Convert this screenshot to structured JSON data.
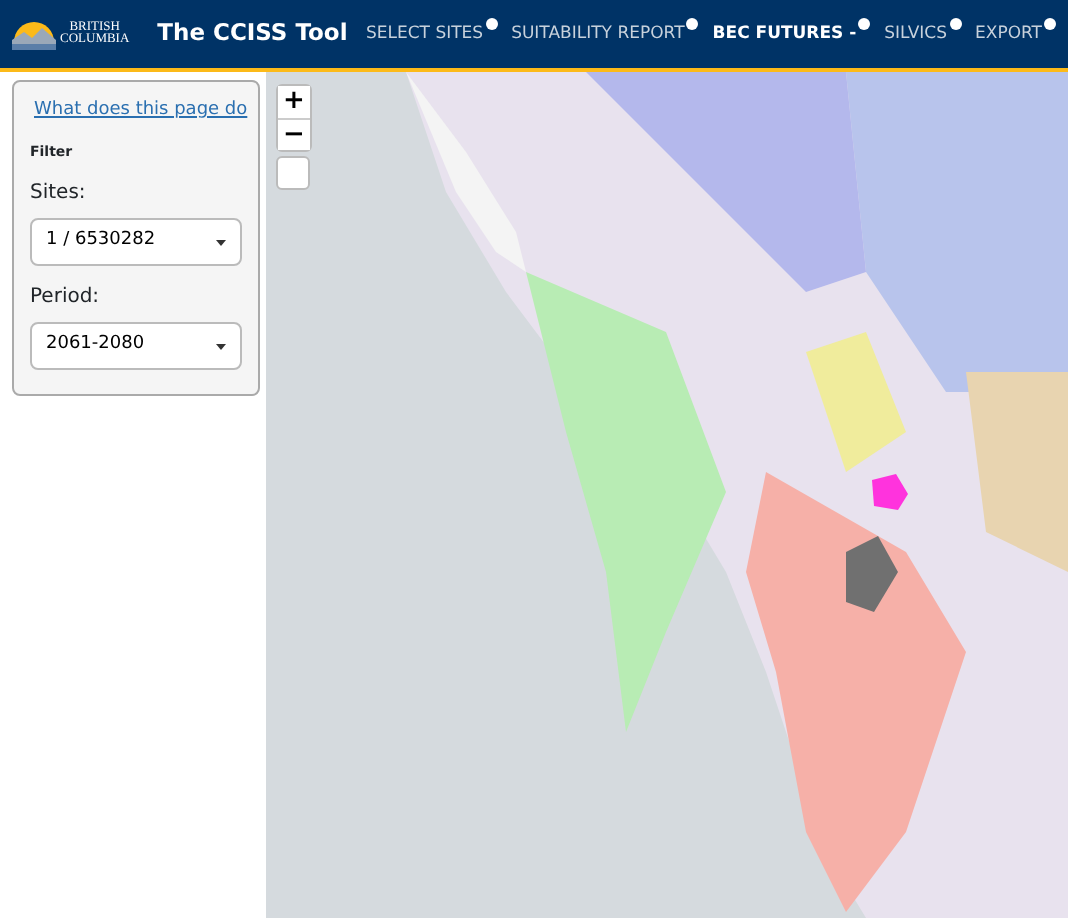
{
  "header": {
    "logo_lines": [
      "BRITISH",
      "COLUMBIA"
    ],
    "title": "The CCISS Tool"
  },
  "nav": [
    {
      "label": "SELECT SITES",
      "selected": false
    },
    {
      "label": "SUITABILITY REPORT",
      "selected": false
    },
    {
      "label": "BEC FUTURES -",
      "selected": true
    },
    {
      "label": "SILVICS",
      "selected": false
    },
    {
      "label": "EXPORT",
      "selected": false
    }
  ],
  "sidebar": {
    "help_link": "What does this page do",
    "heading": "Filter",
    "fields": [
      {
        "label": "Sites:",
        "value": "1 / 6530282"
      },
      {
        "label": "Period:",
        "value": "2061-2080"
      }
    ]
  },
  "map": {
    "zoom_in": "+",
    "zoom_out": "−"
  }
}
